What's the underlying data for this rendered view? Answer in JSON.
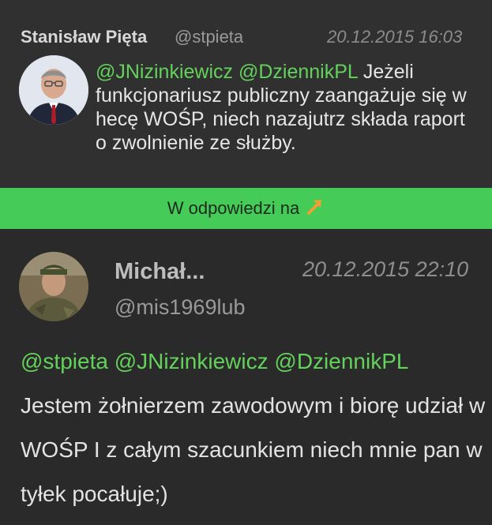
{
  "tweet1": {
    "author_name": "Stanisław Pięta",
    "handle": "@stpieta",
    "timestamp": "20.12.2015 16:03",
    "mentions": [
      "@JNizinkiewicz",
      "@DziennikPL"
    ],
    "text": "Jeżeli funkcjonariusz publiczny zaangażuje się w hecę WOŚP, niech nazajutrz składa raport o zwolnienie ze służby."
  },
  "reply_bar": {
    "label": "W odpowiedzi na",
    "icon": "arrow-up-right-icon"
  },
  "tweet2": {
    "author_name": "Michał...",
    "handle": "@mis1969lub",
    "timestamp": "20.12.2015 22:10",
    "mentions": [
      "@stpieta",
      "@JNizinkiewicz",
      "@DziennikPL"
    ],
    "text": "Jestem żołnierzem zawodowym i biorę udział w WOŚP I z całym szacunkiem niech mnie pan w tyłek pocałuje;)"
  },
  "colors": {
    "background": "#2a2a2a",
    "mention": "#63d25a",
    "reply_bar": "#45cc58",
    "arrow": "#f0a030"
  }
}
